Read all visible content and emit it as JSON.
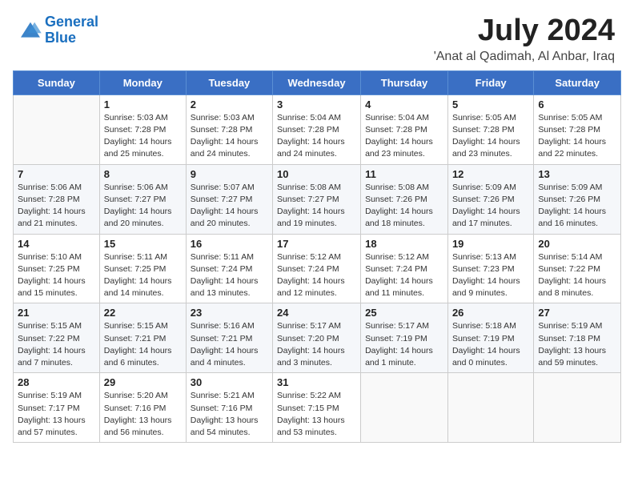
{
  "header": {
    "logo_line1": "General",
    "logo_line2": "Blue",
    "month": "July 2024",
    "location": "'Anat al Qadimah, Al Anbar, Iraq"
  },
  "days_of_week": [
    "Sunday",
    "Monday",
    "Tuesday",
    "Wednesday",
    "Thursday",
    "Friday",
    "Saturday"
  ],
  "weeks": [
    [
      {
        "num": "",
        "info": ""
      },
      {
        "num": "1",
        "info": "Sunrise: 5:03 AM\nSunset: 7:28 PM\nDaylight: 14 hours\nand 25 minutes."
      },
      {
        "num": "2",
        "info": "Sunrise: 5:03 AM\nSunset: 7:28 PM\nDaylight: 14 hours\nand 24 minutes."
      },
      {
        "num": "3",
        "info": "Sunrise: 5:04 AM\nSunset: 7:28 PM\nDaylight: 14 hours\nand 24 minutes."
      },
      {
        "num": "4",
        "info": "Sunrise: 5:04 AM\nSunset: 7:28 PM\nDaylight: 14 hours\nand 23 minutes."
      },
      {
        "num": "5",
        "info": "Sunrise: 5:05 AM\nSunset: 7:28 PM\nDaylight: 14 hours\nand 23 minutes."
      },
      {
        "num": "6",
        "info": "Sunrise: 5:05 AM\nSunset: 7:28 PM\nDaylight: 14 hours\nand 22 minutes."
      }
    ],
    [
      {
        "num": "7",
        "info": "Sunrise: 5:06 AM\nSunset: 7:28 PM\nDaylight: 14 hours\nand 21 minutes."
      },
      {
        "num": "8",
        "info": "Sunrise: 5:06 AM\nSunset: 7:27 PM\nDaylight: 14 hours\nand 20 minutes."
      },
      {
        "num": "9",
        "info": "Sunrise: 5:07 AM\nSunset: 7:27 PM\nDaylight: 14 hours\nand 20 minutes."
      },
      {
        "num": "10",
        "info": "Sunrise: 5:08 AM\nSunset: 7:27 PM\nDaylight: 14 hours\nand 19 minutes."
      },
      {
        "num": "11",
        "info": "Sunrise: 5:08 AM\nSunset: 7:26 PM\nDaylight: 14 hours\nand 18 minutes."
      },
      {
        "num": "12",
        "info": "Sunrise: 5:09 AM\nSunset: 7:26 PM\nDaylight: 14 hours\nand 17 minutes."
      },
      {
        "num": "13",
        "info": "Sunrise: 5:09 AM\nSunset: 7:26 PM\nDaylight: 14 hours\nand 16 minutes."
      }
    ],
    [
      {
        "num": "14",
        "info": "Sunrise: 5:10 AM\nSunset: 7:25 PM\nDaylight: 14 hours\nand 15 minutes."
      },
      {
        "num": "15",
        "info": "Sunrise: 5:11 AM\nSunset: 7:25 PM\nDaylight: 14 hours\nand 14 minutes."
      },
      {
        "num": "16",
        "info": "Sunrise: 5:11 AM\nSunset: 7:24 PM\nDaylight: 14 hours\nand 13 minutes."
      },
      {
        "num": "17",
        "info": "Sunrise: 5:12 AM\nSunset: 7:24 PM\nDaylight: 14 hours\nand 12 minutes."
      },
      {
        "num": "18",
        "info": "Sunrise: 5:12 AM\nSunset: 7:24 PM\nDaylight: 14 hours\nand 11 minutes."
      },
      {
        "num": "19",
        "info": "Sunrise: 5:13 AM\nSunset: 7:23 PM\nDaylight: 14 hours\nand 9 minutes."
      },
      {
        "num": "20",
        "info": "Sunrise: 5:14 AM\nSunset: 7:22 PM\nDaylight: 14 hours\nand 8 minutes."
      }
    ],
    [
      {
        "num": "21",
        "info": "Sunrise: 5:15 AM\nSunset: 7:22 PM\nDaylight: 14 hours\nand 7 minutes."
      },
      {
        "num": "22",
        "info": "Sunrise: 5:15 AM\nSunset: 7:21 PM\nDaylight: 14 hours\nand 6 minutes."
      },
      {
        "num": "23",
        "info": "Sunrise: 5:16 AM\nSunset: 7:21 PM\nDaylight: 14 hours\nand 4 minutes."
      },
      {
        "num": "24",
        "info": "Sunrise: 5:17 AM\nSunset: 7:20 PM\nDaylight: 14 hours\nand 3 minutes."
      },
      {
        "num": "25",
        "info": "Sunrise: 5:17 AM\nSunset: 7:19 PM\nDaylight: 14 hours\nand 1 minute."
      },
      {
        "num": "26",
        "info": "Sunrise: 5:18 AM\nSunset: 7:19 PM\nDaylight: 14 hours\nand 0 minutes."
      },
      {
        "num": "27",
        "info": "Sunrise: 5:19 AM\nSunset: 7:18 PM\nDaylight: 13 hours\nand 59 minutes."
      }
    ],
    [
      {
        "num": "28",
        "info": "Sunrise: 5:19 AM\nSunset: 7:17 PM\nDaylight: 13 hours\nand 57 minutes."
      },
      {
        "num": "29",
        "info": "Sunrise: 5:20 AM\nSunset: 7:16 PM\nDaylight: 13 hours\nand 56 minutes."
      },
      {
        "num": "30",
        "info": "Sunrise: 5:21 AM\nSunset: 7:16 PM\nDaylight: 13 hours\nand 54 minutes."
      },
      {
        "num": "31",
        "info": "Sunrise: 5:22 AM\nSunset: 7:15 PM\nDaylight: 13 hours\nand 53 minutes."
      },
      {
        "num": "",
        "info": ""
      },
      {
        "num": "",
        "info": ""
      },
      {
        "num": "",
        "info": ""
      }
    ]
  ]
}
